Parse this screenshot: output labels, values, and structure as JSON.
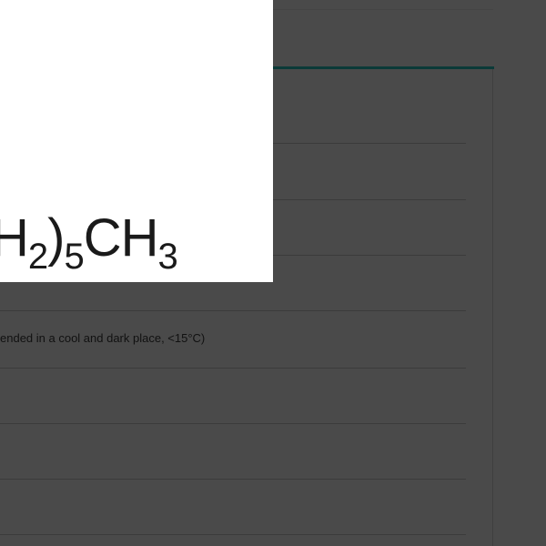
{
  "structure_image": {
    "formula_start": "H",
    "formula_sub_1": "2",
    "formula_paren": ")",
    "formula_sub_2": "5",
    "formula_end": "CH",
    "formula_sub_3": "3"
  },
  "spec_rows": [
    {
      "text": ""
    },
    {
      "text": ""
    },
    {
      "text": ""
    },
    {
      "text": "ended in a cool and dark place, <15°C)"
    },
    {
      "text": ""
    },
    {
      "text": ""
    },
    {
      "text": ""
    }
  ]
}
